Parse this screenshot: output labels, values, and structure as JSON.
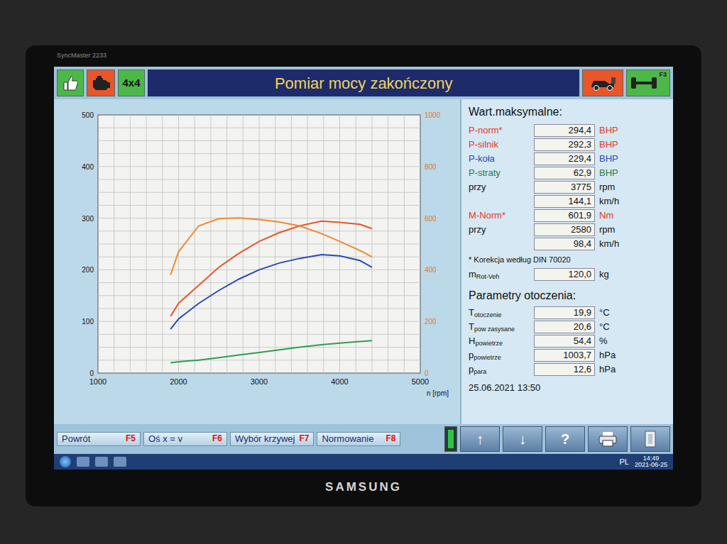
{
  "monitor": {
    "model": "SyncMaster 2233",
    "brand": "SAMSUNG"
  },
  "toolbar": {
    "left_icons": [
      {
        "kind": "thumb",
        "color": "#4cb848"
      },
      {
        "kind": "engine",
        "color": "#e8562a"
      },
      {
        "kind": "text",
        "label": "4x4",
        "color": "#4cb848"
      }
    ],
    "title": "Pomiar mocy zakończony",
    "right_icons": [
      {
        "kind": "car",
        "color": "#e8562a",
        "fkey": ""
      },
      {
        "kind": "axle",
        "color": "#4cb848",
        "fkey": "F3"
      }
    ]
  },
  "chart": {
    "x_ticks": [
      "1000",
      "2000",
      "3000",
      "4000",
      "5000"
    ],
    "x_label": "n [rpm]",
    "y_left_ticks": [
      "0",
      "100",
      "200",
      "300",
      "400",
      "500"
    ],
    "y_right_ticks": [
      "0",
      "200",
      "400",
      "600",
      "800",
      "1000"
    ],
    "rpm": [
      1900,
      2000,
      2250,
      2500,
      2750,
      3000,
      3250,
      3500,
      3775,
      4000,
      4250,
      4400
    ],
    "series": [
      {
        "name": "P-norm",
        "axis": "left",
        "color": "#e8562a",
        "values": [
          110,
          135,
          170,
          205,
          232,
          255,
          272,
          285,
          294.4,
          292,
          288,
          280
        ]
      },
      {
        "name": "M-norm",
        "axis": "right",
        "color": "#f08a2c",
        "values": [
          380,
          470,
          570,
          598,
          601,
          595,
          585,
          570,
          540,
          510,
          475,
          450
        ]
      },
      {
        "name": "P-koła",
        "axis": "left",
        "color": "#2a49b8",
        "values": [
          85,
          105,
          135,
          160,
          182,
          200,
          213,
          222,
          229.4,
          227,
          218,
          205
        ]
      },
      {
        "name": "P-straty",
        "axis": "left",
        "color": "#2e9e4f",
        "values": [
          20,
          22,
          25,
          30,
          35,
          40,
          45,
          50,
          55,
          58,
          61,
          62.9
        ]
      }
    ]
  },
  "max_values": {
    "title": "Wart.maksymalne:",
    "rows": [
      {
        "label": "P-norm*",
        "value": "294,4",
        "unit": "BHP",
        "color": "#e8362a"
      },
      {
        "label": "P-silnik",
        "value": "292,3",
        "unit": "BHP",
        "color": "#e8362a"
      },
      {
        "label": "P-koła",
        "value": "229,4",
        "unit": "BHP",
        "color": "#2a49b8"
      },
      {
        "label": "P-straty",
        "value": "62,9",
        "unit": "BHP",
        "color": "#1e7d3c"
      },
      {
        "label": "przy",
        "value": "3775",
        "unit": "rpm",
        "color": "#111111"
      },
      {
        "label": "",
        "value": "144,1",
        "unit": "km/h",
        "color": "#111111"
      },
      {
        "label": "M-Norm*",
        "value": "601,9",
        "unit": "Nm",
        "color": "#e8362a"
      },
      {
        "label": "przy",
        "value": "2580",
        "unit": "rpm",
        "color": "#111111"
      },
      {
        "label": "",
        "value": "98,4",
        "unit": "km/h",
        "color": "#111111"
      }
    ],
    "note": "* Korekcja według DIN 70020",
    "mass": {
      "label": "m",
      "sub": "Rot-Veh",
      "value": "120,0",
      "unit": "kg"
    }
  },
  "ambient": {
    "title": "Parametry otoczenia:",
    "rows": [
      {
        "label": "T",
        "sub": "otoczenie",
        "value": "19,9",
        "unit": "°C"
      },
      {
        "label": "T",
        "sub": "pow zasysane",
        "value": "20,6",
        "unit": "°C"
      },
      {
        "label": "H",
        "sub": "powietrze",
        "value": "54,4",
        "unit": "%"
      },
      {
        "label": "p",
        "sub": "powietrze",
        "value": "1003,7",
        "unit": "hPa"
      },
      {
        "label": "p",
        "sub": "para",
        "value": "12,6",
        "unit": "hPa"
      }
    ]
  },
  "timestamp": "25.06.2021 13:50",
  "buttons": [
    {
      "label": "Powrót",
      "fkey": "F5"
    },
    {
      "label": "Oś x = v",
      "fkey": "F6"
    },
    {
      "label": "Wybór krzywej",
      "fkey": "F7"
    },
    {
      "label": "Normowanie",
      "fkey": "F8"
    }
  ],
  "icon_buttons": [
    {
      "kind": "indicator"
    },
    {
      "kind": "text",
      "label": "↑"
    },
    {
      "kind": "text",
      "label": "↓"
    },
    {
      "kind": "text",
      "label": "?"
    },
    {
      "kind": "printer"
    },
    {
      "kind": "exit"
    }
  ],
  "taskbar": {
    "language": "PL",
    "time": "14:49",
    "date": "2021-06-25"
  }
}
